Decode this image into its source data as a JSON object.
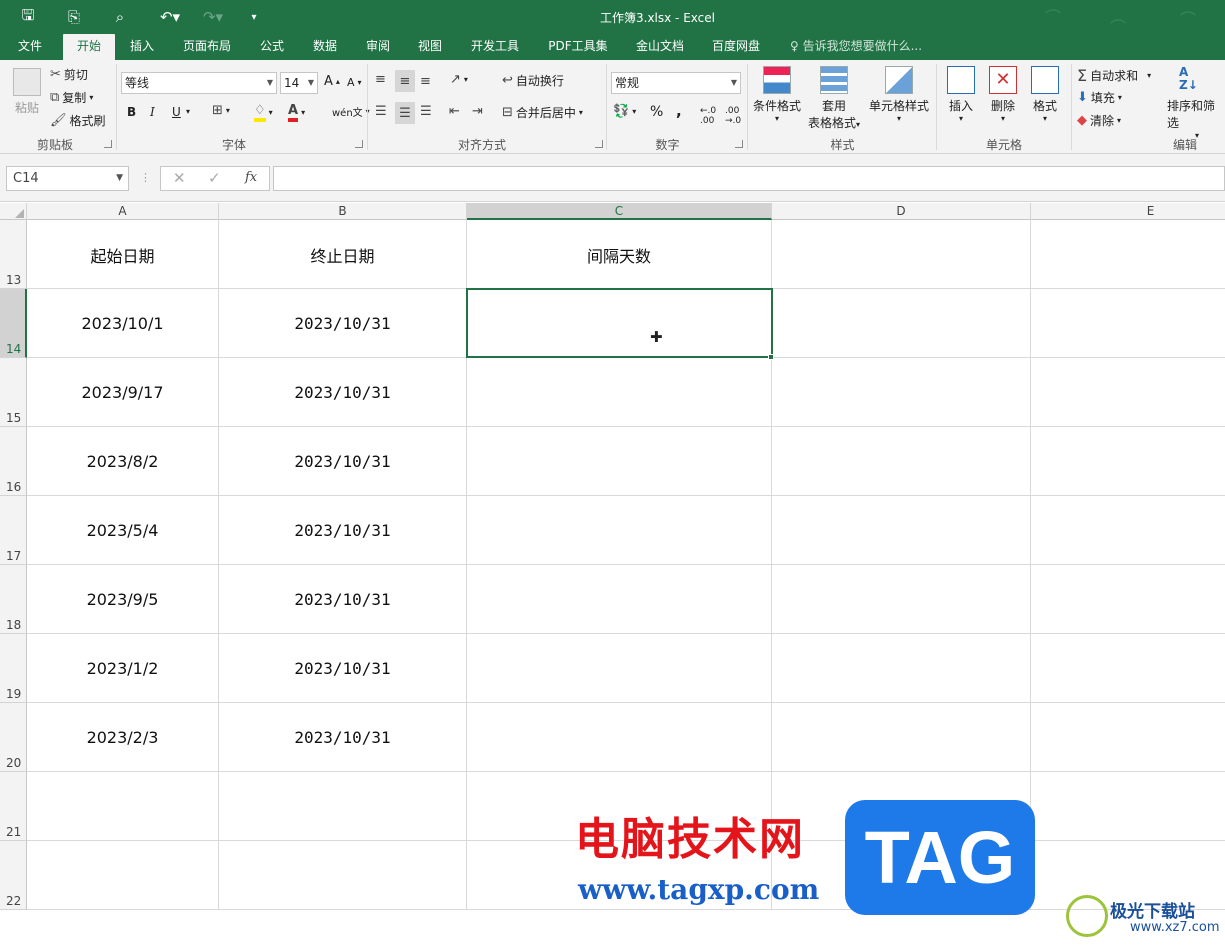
{
  "window": {
    "title": "工作簿3.xlsx - Excel"
  },
  "tabs": [
    {
      "label": "文件"
    },
    {
      "label": "开始"
    },
    {
      "label": "插入"
    },
    {
      "label": "页面布局"
    },
    {
      "label": "公式"
    },
    {
      "label": "数据"
    },
    {
      "label": "审阅"
    },
    {
      "label": "视图"
    },
    {
      "label": "开发工具"
    },
    {
      "label": "PDF工具集"
    },
    {
      "label": "金山文档"
    },
    {
      "label": "百度网盘"
    }
  ],
  "tell_me": "告诉我您想要做什么...",
  "ribbon": {
    "clipboard": {
      "paste": "粘贴",
      "cut": "剪切",
      "copy": "复制",
      "format_painter": "格式刷",
      "label": "剪贴板"
    },
    "font": {
      "name": "等线",
      "size": "14",
      "bold": "B",
      "italic": "I",
      "underline": "U",
      "label": "字体"
    },
    "alignment": {
      "wrap": "自动换行",
      "merge": "合并后居中",
      "label": "对齐方式"
    },
    "number": {
      "format": "常规",
      "percent": "%",
      "comma": ",",
      "label": "数字"
    },
    "styles": {
      "conditional": "条件格式",
      "table_l1": "套用",
      "table_l2": "表格格式",
      "cell_styles": "单元格样式",
      "label": "样式"
    },
    "cells": {
      "insert": "插入",
      "delete": "删除",
      "format": "格式",
      "label": "单元格"
    },
    "editing": {
      "autosum": "自动求和",
      "fill": "填充",
      "clear": "清除",
      "sort": "排序和筛选",
      "label": "编辑"
    }
  },
  "formula_bar": {
    "name_box": "C14",
    "value": ""
  },
  "columns": [
    "A",
    "B",
    "C",
    "D",
    "E"
  ],
  "selected_column": "C",
  "rows": [
    {
      "num": "13",
      "a": "起始日期",
      "b": "终止日期",
      "c": "间隔天数"
    },
    {
      "num": "14",
      "a": "2023/10/1",
      "b": "2023/10/31",
      "c": ""
    },
    {
      "num": "15",
      "a": "2023/9/17",
      "b": "2023/10/31",
      "c": ""
    },
    {
      "num": "16",
      "a": "2023/8/2",
      "b": "2023/10/31",
      "c": ""
    },
    {
      "num": "17",
      "a": "2023/5/4",
      "b": "2023/10/31",
      "c": ""
    },
    {
      "num": "18",
      "a": "2023/9/5",
      "b": "2023/10/31",
      "c": ""
    },
    {
      "num": "19",
      "a": "2023/1/2",
      "b": "2023/10/31",
      "c": ""
    },
    {
      "num": "20",
      "a": "2023/2/3",
      "b": "2023/10/31",
      "c": ""
    },
    {
      "num": "21",
      "a": "",
      "b": "",
      "c": ""
    },
    {
      "num": "22",
      "a": "",
      "b": "",
      "c": ""
    }
  ],
  "watermark": {
    "cn": "电脑技术网",
    "url": "www.tagxp.com",
    "tag": "TAG",
    "site_cn": "极光下载站",
    "site_url": "www.xz7.com"
  }
}
